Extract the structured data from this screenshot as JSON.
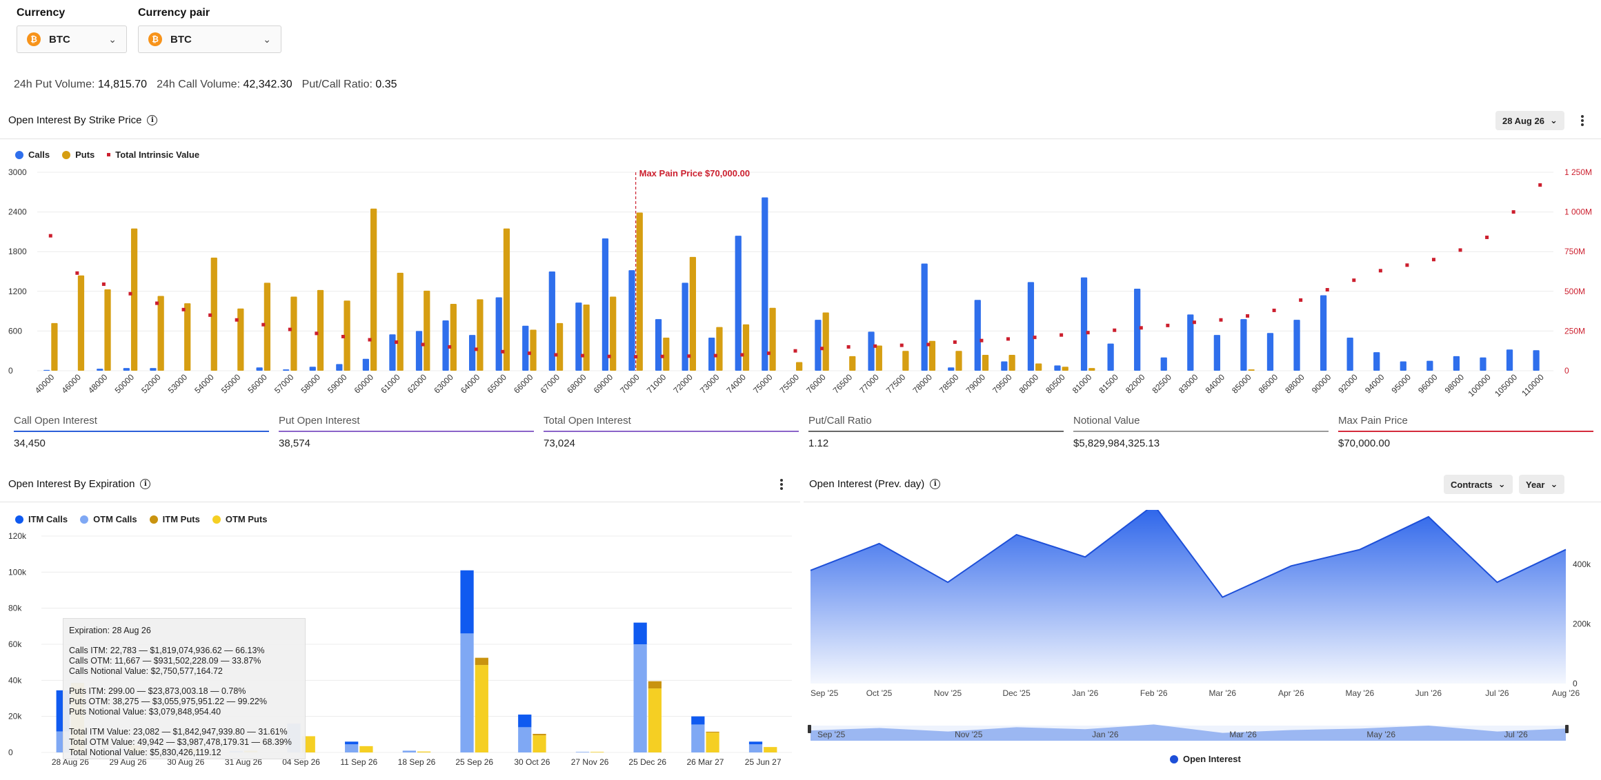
{
  "filters": {
    "currency_label": "Currency",
    "currency_value": "BTC",
    "pair_label": "Currency pair",
    "pair_value": "BTC",
    "coin_symbol": "₿"
  },
  "volumes": {
    "put_label": "24h Put Volume:",
    "put_value": "14,815.70",
    "call_label": "24h Call Volume:",
    "call_value": "42,342.30",
    "ratio_label": "Put/Call Ratio:",
    "ratio_value": "0.35"
  },
  "strike_section": {
    "title": "Open Interest By Strike Price",
    "date_button": "28 Aug 26",
    "legend": [
      "Calls",
      "Puts",
      "Total Intrinsic Value"
    ]
  },
  "stats": [
    {
      "label": "Call Open Interest",
      "value": "34,450",
      "color": "#2b5fd9"
    },
    {
      "label": "Put Open Interest",
      "value": "38,574",
      "color": "#8a63c8"
    },
    {
      "label": "Total Open Interest",
      "value": "73,024",
      "color": "#8a63c8"
    },
    {
      "label": "Put/Call Ratio",
      "value": "1.12",
      "color": "#666666"
    },
    {
      "label": "Notional Value",
      "value": "$5,829,984,325.13",
      "color": "#999999"
    },
    {
      "label": "Max Pain Price",
      "value": "$70,000.00",
      "color": "#d42a3a"
    }
  ],
  "expiration_section": {
    "title": "Open Interest By Expiration",
    "legend": [
      "ITM Calls",
      "OTM Calls",
      "ITM Puts",
      "OTM Puts"
    ]
  },
  "tooltip": {
    "expiration": "Expiration: 28 Aug 26",
    "lines_calls": [
      "Calls ITM: 22,783 — $1,819,074,936.62 — 66.13%",
      "Calls OTM: 11,667 — $931,502,228.09 — 33.87%",
      "Calls Notional Value: $2,750,577,164.72"
    ],
    "lines_puts": [
      "Puts ITM: 299.00 — $23,873,003.18 — 0.78%",
      "Puts OTM: 38,275 — $3,055,975,951.22 — 99.22%",
      "Puts Notional Value: $3,079,848,954.40"
    ],
    "lines_total": [
      "Total ITM Value: 23,082 — $1,842,947,939.80 — 31.61%",
      "Total OTM Value: 49,942 — $3,987,478,179.31 — 68.39%",
      "Total Notional Value: $5,830,426,119.12"
    ]
  },
  "prev_section": {
    "title": "Open Interest (Prev. day)",
    "contracts_button": "Contracts",
    "year_button": "Year",
    "legend": "Open Interest"
  },
  "colors": {
    "calls": "#2f6fec",
    "puts": "#d69e12",
    "intrinsic": "#cc1f2e",
    "itm_calls": "#0f5af0",
    "otm_calls": "#7fa8f4",
    "itm_puts": "#c9930f",
    "otm_puts": "#f5cf23",
    "area": "#2a63ea"
  },
  "chart_data": [
    {
      "type": "bar",
      "title": "Open Interest By Strike Price",
      "categories": [
        "40000",
        "46000",
        "48000",
        "50000",
        "52000",
        "53000",
        "54000",
        "55000",
        "56000",
        "57000",
        "58000",
        "59000",
        "60000",
        "61000",
        "62000",
        "63000",
        "64000",
        "65000",
        "66000",
        "67000",
        "68000",
        "69000",
        "70000",
        "71000",
        "72000",
        "73000",
        "74000",
        "75000",
        "75500",
        "76000",
        "76500",
        "77000",
        "77500",
        "78000",
        "78500",
        "79000",
        "79500",
        "80000",
        "80500",
        "81000",
        "81500",
        "82000",
        "82500",
        "83000",
        "84000",
        "85000",
        "86000",
        "88000",
        "90000",
        "92000",
        "94000",
        "95000",
        "96000",
        "98000",
        "100000",
        "105000",
        "110000"
      ],
      "series": [
        {
          "name": "Calls",
          "values": [
            12,
            0,
            30,
            40,
            40,
            0,
            0,
            0,
            50,
            20,
            60,
            100,
            180,
            550,
            600,
            760,
            540,
            1110,
            680,
            1500,
            1030,
            2000,
            1520,
            780,
            1330,
            500,
            2040,
            2620,
            0,
            770,
            0,
            590,
            0,
            1620,
            50,
            1070,
            140,
            1340,
            80,
            1410,
            410,
            1240,
            200,
            850,
            540,
            780,
            570,
            770,
            1140,
            500,
            280,
            140,
            150,
            220,
            200,
            320,
            310
          ]
        },
        {
          "name": "Puts",
          "values": [
            720,
            1440,
            1230,
            2150,
            1130,
            1020,
            1710,
            940,
            1330,
            1120,
            1220,
            1060,
            2450,
            1480,
            1210,
            1010,
            1080,
            2150,
            620,
            720,
            1000,
            1120,
            2390,
            500,
            1720,
            660,
            700,
            950,
            130,
            880,
            220,
            380,
            300,
            450,
            300,
            240,
            240,
            110,
            60,
            40,
            0,
            0,
            0,
            0,
            0,
            20,
            0,
            0,
            0,
            0,
            0,
            0,
            0,
            0,
            0,
            0,
            0
          ]
        },
        {
          "name": "Total Intrinsic Value",
          "axis": "right",
          "values": [
            850000000,
            615000000,
            545000000,
            485000000,
            425000000,
            385000000,
            350000000,
            320000000,
            290000000,
            260000000,
            235000000,
            215000000,
            195000000,
            180000000,
            165000000,
            150000000,
            135000000,
            120000000,
            110000000,
            100000000,
            95000000,
            90000000,
            88000000,
            90000000,
            92000000,
            95000000,
            100000000,
            110000000,
            125000000,
            140000000,
            150000000,
            155000000,
            160000000,
            165000000,
            180000000,
            190000000,
            200000000,
            210000000,
            225000000,
            240000000,
            255000000,
            270000000,
            285000000,
            305000000,
            320000000,
            345000000,
            380000000,
            445000000,
            510000000,
            570000000,
            630000000,
            665000000,
            700000000,
            760000000,
            840000000,
            1000000000,
            1170000000
          ]
        }
      ],
      "ylim": [
        0,
        3000
      ],
      "yticks": [
        "0",
        "600",
        "1200",
        "1800",
        "2400",
        "3000"
      ],
      "y2ticks": [
        "0",
        "250M",
        "500M",
        "750M",
        "1 000M",
        "1 250M"
      ],
      "y2lim": [
        0,
        1250000000
      ],
      "annotation": {
        "label": "Max Pain Price $70,000.00",
        "category": "70000"
      }
    },
    {
      "type": "bar",
      "title": "Open Interest By Expiration",
      "categories": [
        "28 Aug 26",
        "29 Aug 26",
        "30 Aug 26",
        "31 Aug 26",
        "04 Sep 26",
        "11 Sep 26",
        "18 Sep 26",
        "25 Sep 26",
        "30 Oct 26",
        "27 Nov 26",
        "25 Dec 26",
        "26 Mar 27",
        "25 Jun 27"
      ],
      "series": [
        {
          "name": "ITM Calls",
          "values": [
            22783,
            0,
            0,
            0,
            0,
            1500,
            0,
            35000,
            7000,
            0,
            12000,
            4500,
            1500
          ]
        },
        {
          "name": "OTM Calls",
          "values": [
            11667,
            2000,
            1000,
            800,
            16000,
            4500,
            1000,
            66000,
            14000,
            300,
            60000,
            15500,
            4500
          ]
        },
        {
          "name": "ITM Puts",
          "values": [
            299,
            0,
            0,
            0,
            0,
            0,
            0,
            4000,
            800,
            0,
            4000,
            500,
            0
          ]
        },
        {
          "name": "OTM Puts",
          "values": [
            38275,
            4000,
            2000,
            1000,
            9000,
            3500,
            500,
            48500,
            9500,
            300,
            35500,
            11000,
            3000
          ]
        }
      ],
      "ylim": [
        0,
        120000
      ],
      "yticks": [
        "0",
        "20k",
        "40k",
        "60k",
        "80k",
        "100k",
        "120k"
      ]
    },
    {
      "type": "area",
      "title": "Open Interest (Prev. day)",
      "x": [
        "Sep '25",
        "Oct '25",
        "Nov '25",
        "Dec '25",
        "Jan '26",
        "Feb '26",
        "Mar '26",
        "Apr '26",
        "May '26",
        "Jun '26",
        "Jul '26",
        "Aug '26"
      ],
      "series": [
        {
          "name": "Open Interest",
          "values": [
            380000,
            470000,
            340000,
            500000,
            425000,
            600000,
            290000,
            395000,
            450000,
            560000,
            340000,
            450000
          ]
        }
      ],
      "ylim": [
        0,
        560000
      ],
      "yticks": [
        "0",
        "200k",
        "400k"
      ]
    }
  ]
}
